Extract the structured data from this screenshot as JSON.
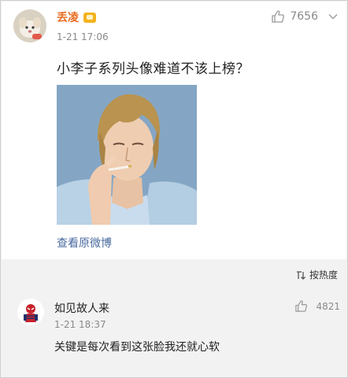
{
  "post": {
    "author": "丢凌",
    "time": "1-21 17:06",
    "likes": "7656",
    "text": "小李子系列头像难道不该上榜？",
    "view_original": "查看原微博"
  },
  "sort": {
    "label": "按热度"
  },
  "comment": {
    "author": "如见故人来",
    "time": "1-21 18:37",
    "likes": "4821",
    "text": "关键是每次看到这张脸我还就心软"
  },
  "icons": {
    "avatar": "puppy-avatar",
    "badge": "vip-emoji-badge",
    "like": "thumbs-up-icon",
    "more": "chevron-down-icon",
    "sort": "sort-icon",
    "comment_avatar": "spiderman-avatar"
  },
  "colors": {
    "author_name": "#e86b1f",
    "link": "#4a6aa0",
    "meta": "#8a8a8a"
  }
}
